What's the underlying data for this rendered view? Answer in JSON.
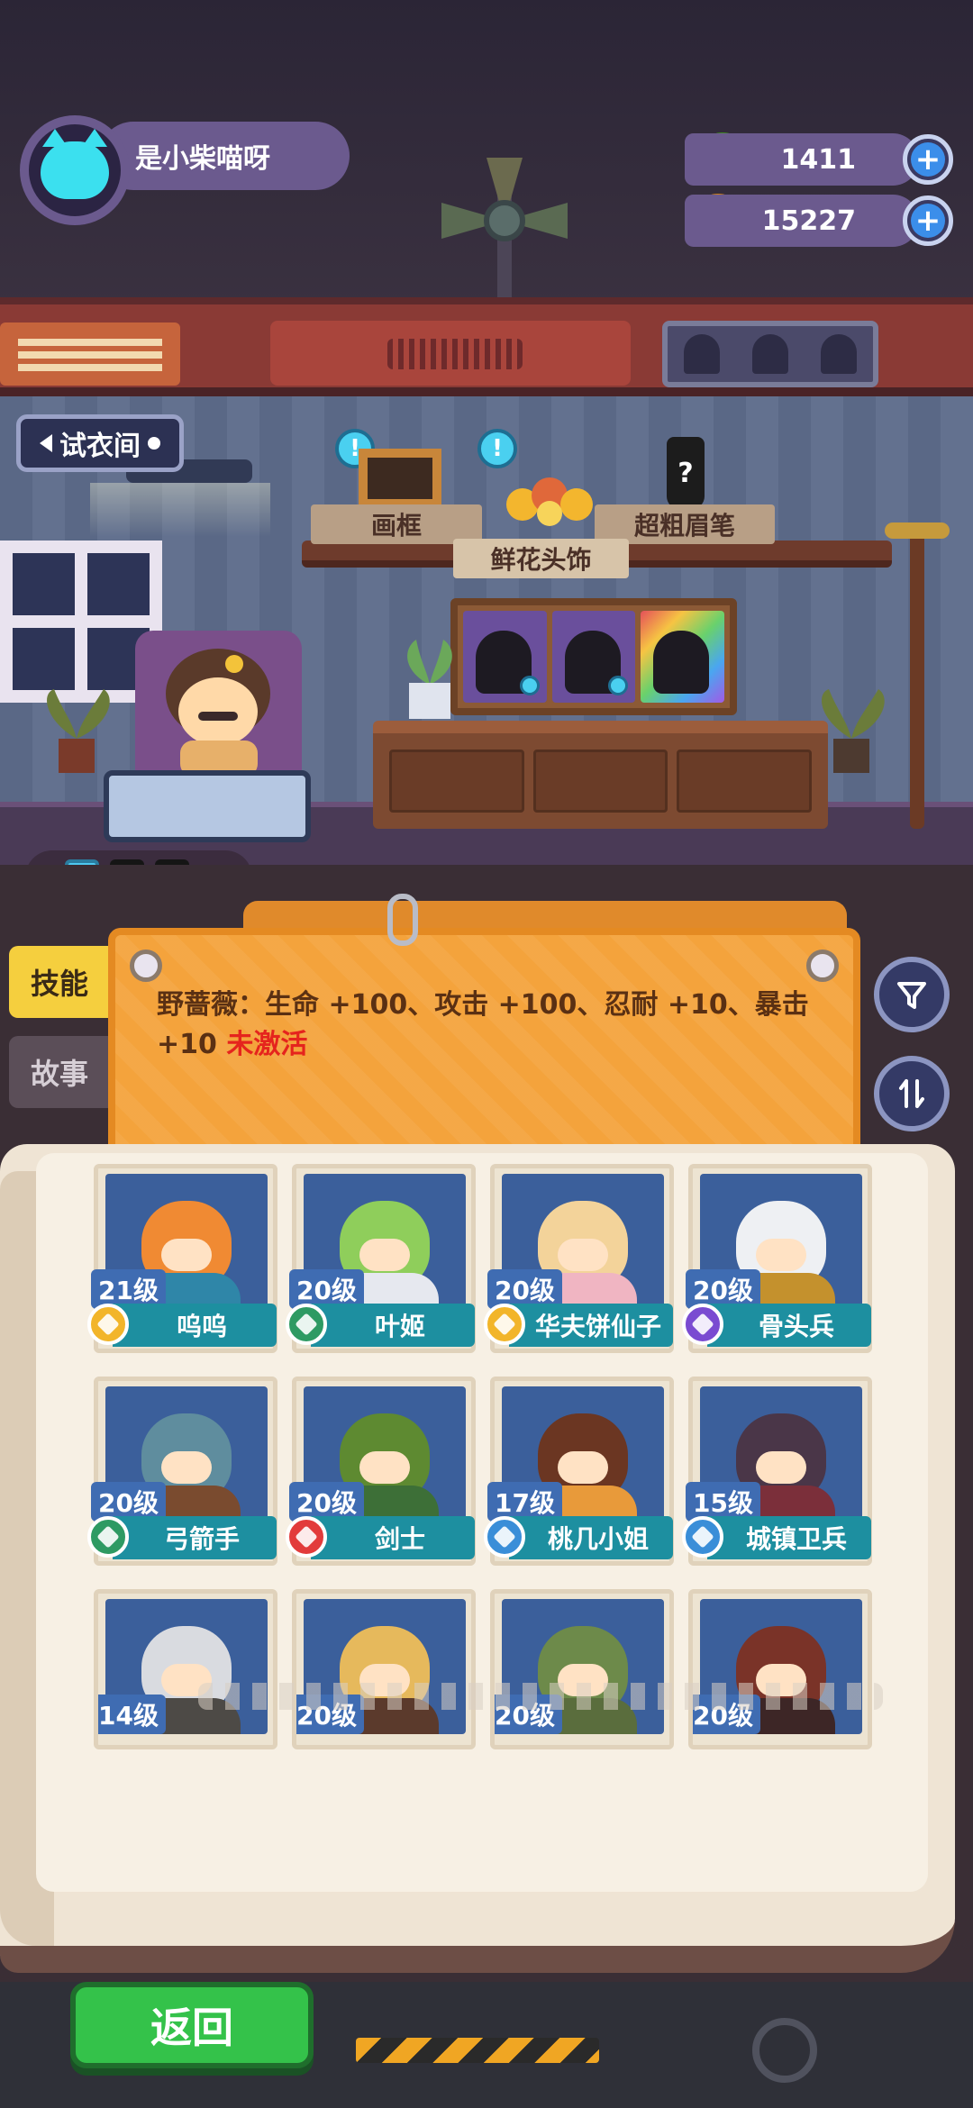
{
  "user": {
    "name": "是小柴喵呀"
  },
  "currency": {
    "gems": "1411",
    "coins": "15227"
  },
  "location": {
    "back_label": "试衣间"
  },
  "shelf": {
    "items": [
      "画框",
      "鲜花头饰",
      "超粗眉笔"
    ],
    "mystery": "?"
  },
  "tabs": {
    "skill": "技能",
    "story": "故事"
  },
  "info": {
    "text": "野蔷薇：生命 +100、攻击 +100、忍耐 +10、暴击 +10",
    "status": "未激活"
  },
  "characters": [
    {
      "level": "21级",
      "name": "呜呜",
      "badge_color": "#f2b52a",
      "hair": "#f08a33",
      "body": "#2f86a8"
    },
    {
      "level": "20级",
      "name": "叶姬",
      "badge_color": "#2e9a63",
      "hair": "#8fce5b",
      "body": "#e6e8ef"
    },
    {
      "level": "20级",
      "name": "华夫饼仙子",
      "badge_color": "#f2b52a",
      "hair": "#f3d39a",
      "body": "#f0b5c2"
    },
    {
      "level": "20级",
      "name": "骨头兵",
      "badge_color": "#7a4bd1",
      "hair": "#eef0f3",
      "body": "#c4912d"
    },
    {
      "level": "20级",
      "name": "弓箭手",
      "badge_color": "#2e9a63",
      "hair": "#5f8d9e",
      "body": "#7a4b2f"
    },
    {
      "level": "20级",
      "name": "剑士",
      "badge_color": "#e23b3b",
      "hair": "#5e8a31",
      "body": "#3d6f37"
    },
    {
      "level": "17级",
      "name": "桃几小姐",
      "badge_color": "#3a8ed8",
      "hair": "#6b3622",
      "body": "#e89a3a"
    },
    {
      "level": "15级",
      "name": "城镇卫兵",
      "badge_color": "#3a8ed8",
      "hair": "#4a3648",
      "body": "#7b2f3a"
    },
    {
      "level": "14级",
      "name": "",
      "hair": "#d9dbe0",
      "body": "#4d4a46"
    },
    {
      "level": "20级",
      "name": "",
      "hair": "#e6b95c",
      "body": "#5b3a2c"
    },
    {
      "level": "20级",
      "name": "",
      "hair": "#6d8a4a",
      "body": "#5a6d3d"
    },
    {
      "level": "20级",
      "name": "",
      "hair": "#7a3328",
      "body": "#3d2626"
    }
  ],
  "footer": {
    "return_label": "返回"
  }
}
